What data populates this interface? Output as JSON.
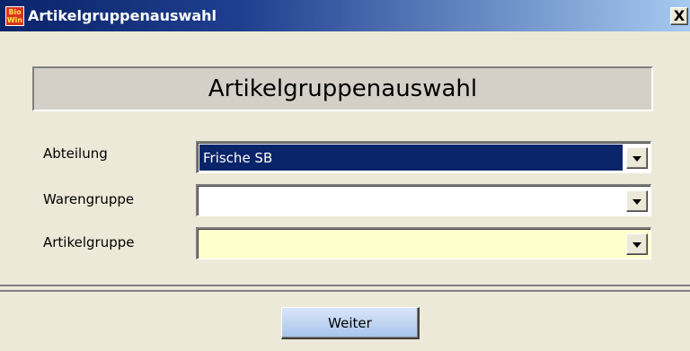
{
  "window": {
    "title": "Artikelgruppenauswahl",
    "app_icon": {
      "name": "biowin-app-icon",
      "line1": "Bio",
      "line2": "Win"
    },
    "close_label": "X"
  },
  "heading": "Artikelgruppenauswahl",
  "form": {
    "abteilung": {
      "label": "Abteilung",
      "value": "Frische SB"
    },
    "warengruppe": {
      "label": "Warengruppe",
      "value": ""
    },
    "artikelgruppe": {
      "label": "Artikelgruppe",
      "value": ""
    }
  },
  "buttons": {
    "weiter": "Weiter"
  },
  "colors": {
    "titlebar_start": "#0a246a",
    "titlebar_end": "#a6caf0",
    "selection": "#0a246a",
    "highlight_field": "#ffffcc",
    "window_bg": "#ece9d8"
  }
}
